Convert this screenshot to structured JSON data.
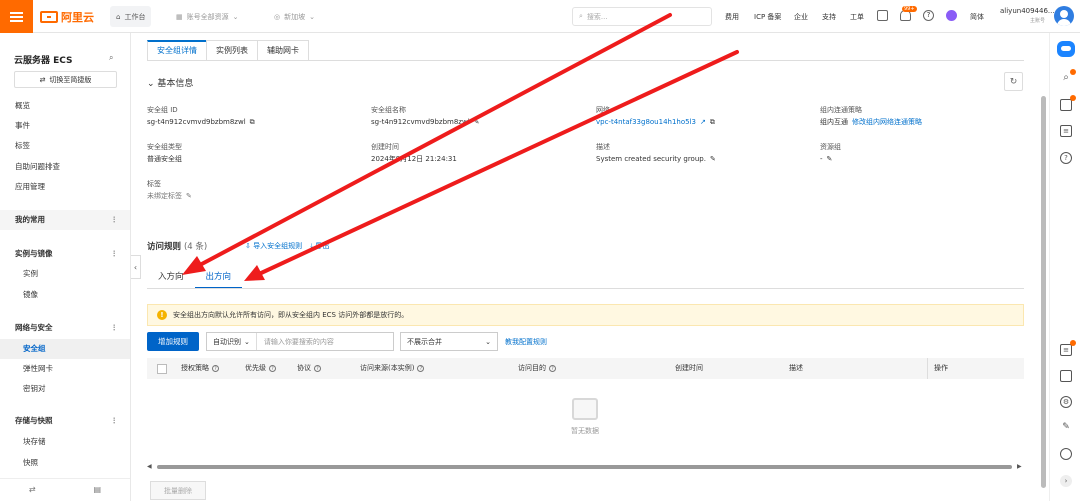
{
  "topbar": {
    "logo_text": "阿里云",
    "workbench": "工作台",
    "account_scope": "账号全部资源",
    "region": "新加坡",
    "search_placeholder": "搜索...",
    "links": [
      "费用",
      "ICP 备案",
      "企业",
      "支持",
      "工单"
    ],
    "notification_badge": "99+",
    "language": "简体",
    "username": "aliyun409446...",
    "account_type": "主账号",
    "accent_color": "#ff6a00"
  },
  "sidebar": {
    "title": "云服务器 ECS",
    "switch_label": "切换至简捷版",
    "items": [
      {
        "label": "概览"
      },
      {
        "label": "事件"
      },
      {
        "label": "标签"
      },
      {
        "label": "自助问题排查"
      },
      {
        "label": "应用管理"
      },
      {
        "label": "我的常用"
      },
      {
        "label": "实例与镜像"
      },
      {
        "label": "实例"
      },
      {
        "label": "镜像"
      },
      {
        "label": "网络与安全"
      },
      {
        "label": "安全组"
      },
      {
        "label": "弹性网卡"
      },
      {
        "label": "密钥对"
      },
      {
        "label": "存储与快照"
      },
      {
        "label": "块存储"
      },
      {
        "label": "快照"
      }
    ]
  },
  "tabs": [
    "安全组详情",
    "实例列表",
    "辅助网卡"
  ],
  "basic_info": {
    "title": "基本信息",
    "fields": {
      "sg_id_label": "安全组 ID",
      "sg_id_value": "sg-t4n912cvmvd9bzbm8zwl",
      "sg_name_label": "安全组名称",
      "sg_name_value": "sg-t4n912cvmvd9bzbm8zwl",
      "network_label": "网络",
      "network_value": "vpc-t4ntaf33g8ou14h1ho5l3",
      "policy_label": "组内连通策略",
      "policy_value": "组内互通",
      "policy_link": "修改组内网络连通策略",
      "type_label": "安全组类型",
      "type_value": "普通安全组",
      "created_label": "创建时间",
      "created_value": "2024年9月12日 21:24:31",
      "desc_label": "描述",
      "desc_value": "System created security group.",
      "rg_label": "资源组",
      "rg_value": "-",
      "tags_label": "标签",
      "tags_value": "未绑定标签"
    }
  },
  "rules": {
    "title": "访问规则",
    "count": "(4 条)",
    "import_link": "导入安全组规则",
    "export_link": "导出",
    "direction_tabs": [
      "入方向",
      "出方向"
    ],
    "active_direction": "出方向",
    "alert_text": "安全组出方向默认允许所有访问，即从安全组内 ECS 访问外部都是放行的。",
    "add_button": "增加规则",
    "filter_mode": "自动识别",
    "filter_placeholder": "请输入你要搜索的内容",
    "merge_option": "不展示合并",
    "teach_link": "教我配置规则",
    "columns": [
      "授权策略",
      "优先级",
      "协议",
      "访问来源(本实例)",
      "访问目的",
      "创建时间",
      "描述",
      "操作"
    ],
    "empty_text": "暂无数据",
    "batch_delete": "批量删除"
  },
  "annotation": {
    "arrow_color": "#ee1c1c"
  }
}
